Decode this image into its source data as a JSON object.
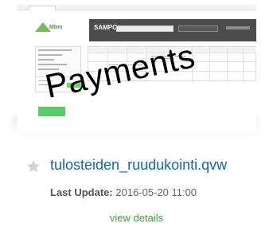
{
  "thumbnail": {
    "app_label": "SAMPO",
    "logo_text": "Mbm",
    "watermark_text": "Payments"
  },
  "document": {
    "title": "tulosteiden_ruudukointi.qvw",
    "last_update_label": "Last Update:",
    "last_update_value": "2016-05-20 11:00",
    "view_details_label": "view details"
  },
  "colors": {
    "link": "#1565c0",
    "accent_green": "#3ea23b",
    "star": "#cfcfcf"
  },
  "icons": {
    "favorite": "star-icon"
  }
}
